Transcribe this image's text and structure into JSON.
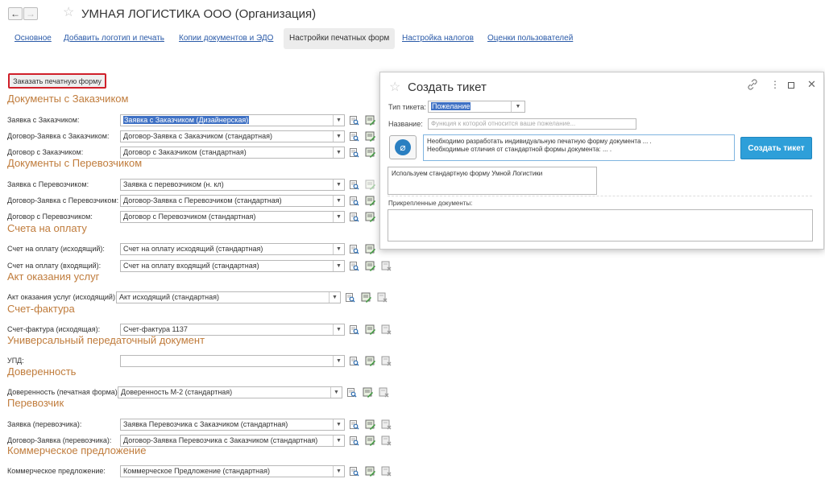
{
  "header": {
    "title": "УМНАЯ ЛОГИСТИКА ООО (Организация)"
  },
  "tabs": [
    {
      "label": "Основное"
    },
    {
      "label": "Добавить логотип и печать"
    },
    {
      "label": "Копии документов и ЭДО"
    },
    {
      "label": "Настройки печатных форм"
    },
    {
      "label": "Настройка налогов"
    },
    {
      "label": "Оценки пользователей"
    }
  ],
  "order_button": {
    "label": "Заказать печатную форму"
  },
  "sections": {
    "customers": "Документы с Заказчиком",
    "carriers": "Документы с Перевозчиком",
    "invoices": "Счета на оплату",
    "acts": "Акт оказания услуг",
    "invoice_facture": "Счет-фактура",
    "upd": "Универсальный передаточный документ",
    "power": "Доверенность",
    "carrier": "Перевозчик",
    "offer": "Коммерческое предложение"
  },
  "rows": [
    {
      "label": "Заявка с Заказчиком:",
      "value": "Заявка с Заказчиком (Дизайнерская)"
    },
    {
      "label": "Договор-Заявка с Заказчиком:",
      "value": "Договор-Заявка с Заказчиком (стандартная)"
    },
    {
      "label": "Договор с Заказчиком:",
      "value": "Договор с Заказчиком (стандартная)"
    },
    {
      "label": "Заявка с Перевозчиком:",
      "value": "Заявка с перевозчиком (н. кл)"
    },
    {
      "label": "Договор-Заявка с Перевозчиком:",
      "value": "Договор-Заявка с Перевозчиком (стандартная)"
    },
    {
      "label": "Договор с Перевозчиком:",
      "value": "Договор с Перевозчиком (стандартная)"
    },
    {
      "label": "Счет на оплату (исходящий):",
      "value": "Счет на оплату исходящий (стандартная)"
    },
    {
      "label": "Счет на оплату (входящий):",
      "value": "Счет на оплату входящий (стандартная)"
    },
    {
      "label": "Акт оказания услуг (исходящий):",
      "value": "Акт исходящий (стандартная)"
    },
    {
      "label": "Счет-фактура (исходящая):",
      "value": "Счет-фактура 1137"
    },
    {
      "label": "УПД:",
      "value": ""
    },
    {
      "label": "Доверенность (печатная форма):",
      "value": "Доверенность М-2 (стандартная)"
    },
    {
      "label": "Заявка (перевозчика):",
      "value": "Заявка Перевозчика с Заказчиком (стандартная)"
    },
    {
      "label": "Договор-Заявка (перевозчика):",
      "value": "Договор-Заявка Перевозчика с Заказчиком (стандартная)"
    },
    {
      "label": "Коммерческое предложение:",
      "value": "Коммерческое Предложение (стандартная)"
    }
  ],
  "modal": {
    "title": "Создать тикет",
    "ticket_type_label": "Тип тикета:",
    "ticket_type_value": "Пожелание",
    "name_label": "Название:",
    "name_placeholder": "Функция к которой относится ваше пожелание...",
    "description_line1": "Необходимо разработать индивидуальную печатную форму документа ... .",
    "description_line2": "Необходимые отличия от стандартной формы документа: ... .",
    "create_button": "Создать тикет",
    "comment": "Используем стандартную форму Умной Логистики",
    "attached_label": "Прикрепленные документы:"
  },
  "colors": {
    "section_heading": "#c07c3c",
    "link": "#2a5aa8",
    "primary_button": "#2e9fd9",
    "highlight_border": "#d0202a",
    "selection": "#3f71c4"
  }
}
